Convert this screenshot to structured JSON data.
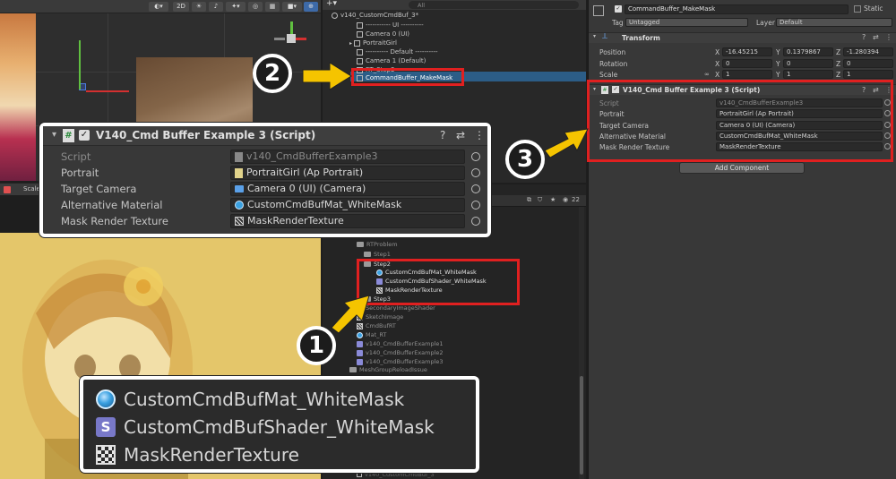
{
  "scene": {
    "mode_2d": "2D"
  },
  "hierarchy": {
    "search_placeholder": "All",
    "items": [
      "v140_CustomCmdBuf_3*",
      "----------- UI ----------",
      "Camera 0 (UI)",
      "PortraitGirl",
      "---------- Default ----------",
      "Camera 1 (Default)",
      "RT_Step2",
      "CommandBuffer_MakeMask"
    ]
  },
  "game": {
    "scale_label": "Scale"
  },
  "project": {
    "badge_count": "22",
    "items": [
      {
        "label": "RTProblem",
        "type": "folder"
      },
      {
        "label": "Step1",
        "type": "folder"
      },
      {
        "label": "Step2",
        "type": "folder"
      },
      {
        "label": "CustomCmdBufMat_WhiteMask",
        "type": "material"
      },
      {
        "label": "CustomCmdBufShader_WhiteMask",
        "type": "shader"
      },
      {
        "label": "MaskRenderTexture",
        "type": "rendertexture"
      },
      {
        "label": "Step3",
        "type": "folder"
      },
      {
        "label": "SecondaryImageShader",
        "type": "file"
      },
      {
        "label": "SketchImage",
        "type": "file"
      },
      {
        "label": "CmdBufRT",
        "type": "file"
      },
      {
        "label": "Mat_RT",
        "type": "file"
      },
      {
        "label": "v140_CmdBufferExample1",
        "type": "file"
      },
      {
        "label": "v140_CmdBufferExample2",
        "type": "file"
      },
      {
        "label": "v140_CmdBufferExample3",
        "type": "file"
      },
      {
        "label": "MeshGroupReloadIssue",
        "type": "folder"
      },
      {
        "label": "v140_CustomCmdBuf_3",
        "type": "file"
      }
    ]
  },
  "inspector": {
    "object_name": "CommandBuffer_MakeMask",
    "static_label": "Static",
    "tag_label": "Tag",
    "tag_value": "Untagged",
    "layer_label": "Layer",
    "layer_value": "Default",
    "transform": {
      "title": "Transform",
      "position_label": "Position",
      "rotation_label": "Rotation",
      "scale_label": "Scale",
      "position": {
        "x": "-16.45215",
        "y": "0.1379867",
        "z": "-1.280394"
      },
      "rotation": {
        "x": "0",
        "y": "0",
        "z": "0"
      },
      "scale": {
        "x": "1",
        "y": "1",
        "z": "1"
      },
      "axis_x": "X",
      "axis_y": "Y",
      "axis_z": "Z"
    },
    "script_component": {
      "title": "V140_Cmd Buffer Example 3 (Script)",
      "rows": [
        {
          "label": "Script",
          "value": "v140_CmdBufferExample3"
        },
        {
          "label": "Portrait",
          "value": "PortraitGirl (Ap Portrait)"
        },
        {
          "label": "Target Camera",
          "value": "Camera 0 (UI) (Camera)"
        },
        {
          "label": "Alternative Material",
          "value": "CustomCmdBufMat_WhiteMask"
        },
        {
          "label": "Mask Render Texture",
          "value": "MaskRenderTexture"
        }
      ]
    },
    "add_component": "Add Component"
  },
  "zoom_inspector": {
    "title": "V140_Cmd Buffer Example 3 (Script)",
    "rows": [
      {
        "label": "Script",
        "value": "v140_CmdBufferExample3"
      },
      {
        "label": "Portrait",
        "value": "PortraitGirl (Ap Portrait)"
      },
      {
        "label": "Target Camera",
        "value": "Camera 0 (UI) (Camera)"
      },
      {
        "label": "Alternative Material",
        "value": "CustomCmdBufMat_WhiteMask"
      },
      {
        "label": "Mask Render Texture",
        "value": "MaskRenderTexture"
      }
    ]
  },
  "zoom_project": {
    "items": [
      {
        "label": "CustomCmdBufMat_WhiteMask",
        "type": "material"
      },
      {
        "label": "CustomCmdBufShader_WhiteMask",
        "type": "shader"
      },
      {
        "label": "MaskRenderTexture",
        "type": "rendertexture"
      }
    ]
  },
  "callouts": {
    "one": "1",
    "two": "2",
    "three": "3"
  },
  "colors": {
    "highlight": "#e02020",
    "arrow": "#f5c400",
    "selection": "#2c5d87"
  }
}
